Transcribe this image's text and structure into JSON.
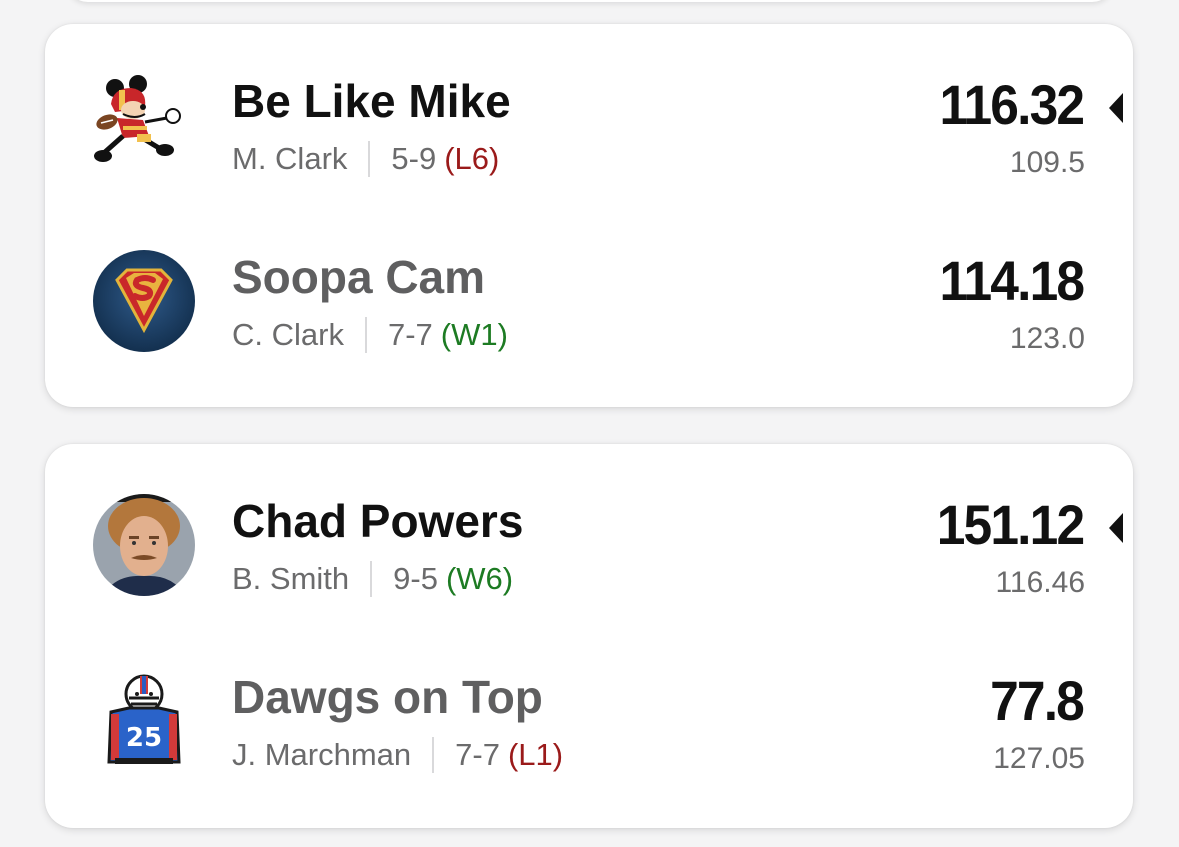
{
  "matchups": [
    {
      "teams": [
        {
          "name": "Be Like Mike",
          "owner": "M. Clark",
          "record": "5-9",
          "streak": "(L6)",
          "score": "116.32",
          "projection": "109.5",
          "avatar_icon": "mickey-football-icon",
          "leading": true
        },
        {
          "name": "Soopa Cam",
          "owner": "C. Clark",
          "record": "7-7",
          "streak": "(W1)",
          "score": "114.18",
          "projection": "123.0",
          "avatar_icon": "superman-shield-icon",
          "leading": false
        }
      ]
    },
    {
      "teams": [
        {
          "name": "Chad Powers",
          "owner": "B. Smith",
          "record": "9-5",
          "streak": "(W6)",
          "score": "151.12",
          "projection": "116.46",
          "avatar_icon": "player-face-photo-icon",
          "leading": true
        },
        {
          "name": "Dawgs on Top",
          "owner": "J. Marchman",
          "record": "7-7",
          "streak": "(L1)",
          "score": "77.8",
          "projection": "127.05",
          "avatar_icon": "football-jersey-icon",
          "avatar_text": "25",
          "leading": false
        }
      ]
    }
  ],
  "colors": {
    "loss_streak": "#9a1a1a",
    "win_streak": "#1d7b23",
    "leader_text": "#111111",
    "trailer_text": "#5f5f60"
  }
}
